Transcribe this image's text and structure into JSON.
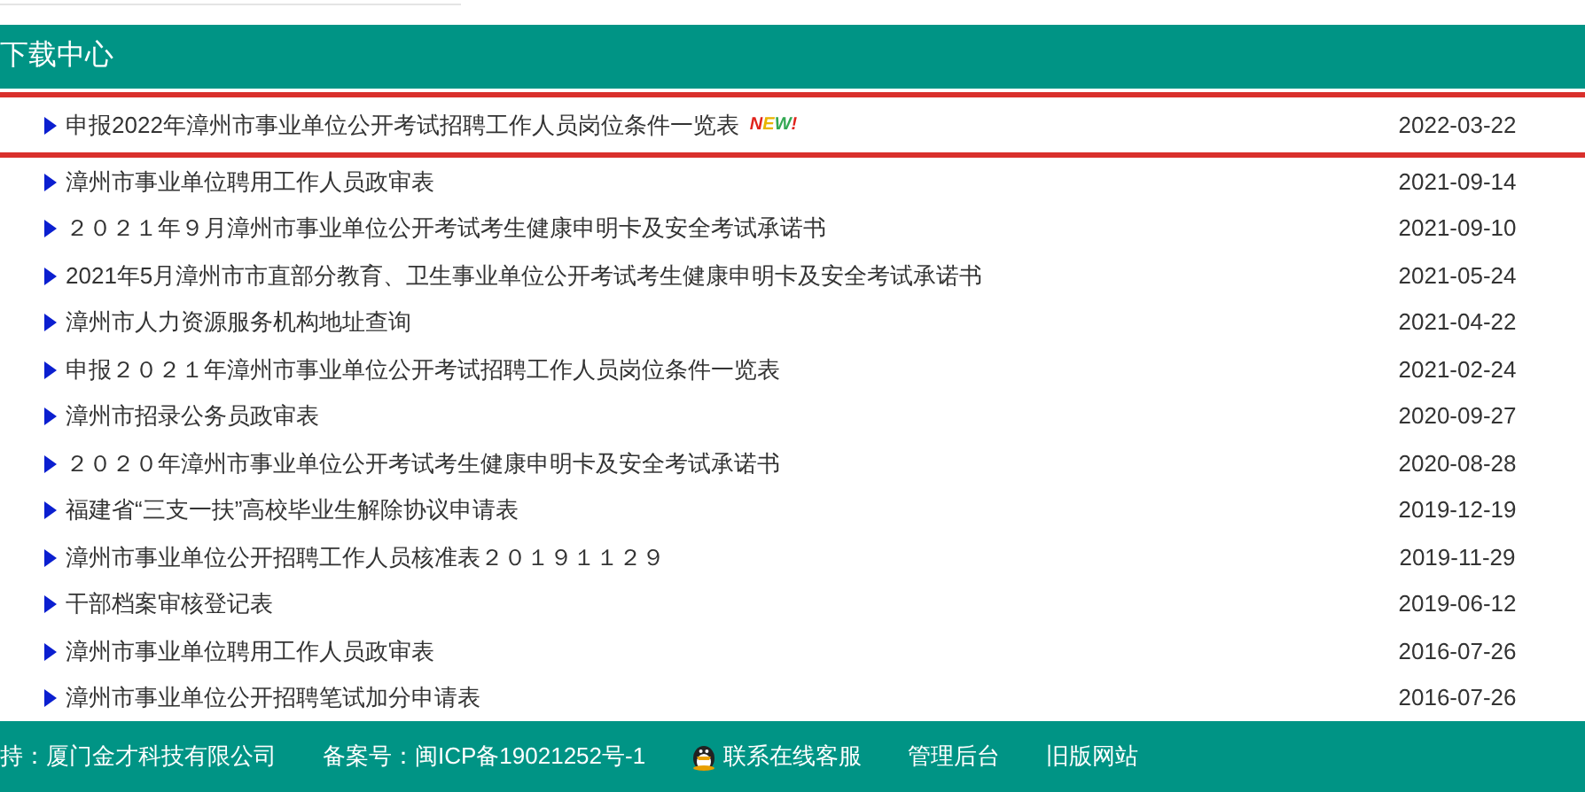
{
  "section": {
    "title": "下载中心"
  },
  "rows": [
    {
      "title": "申报2022年漳州市事业单位公开考试招聘工作人员岗位条件一览表",
      "date": "2022-03-22",
      "highlighted": true,
      "badge": "NEW!"
    },
    {
      "title": "漳州市事业单位聘用工作人员政审表",
      "date": "2021-09-14",
      "highlighted": false
    },
    {
      "title": "２０２１年９月漳州市事业单位公开考试考生健康申明卡及安全考试承诺书",
      "date": "2021-09-10",
      "highlighted": false
    },
    {
      "title": "2021年5月漳州市市直部分教育、卫生事业单位公开考试考生健康申明卡及安全考试承诺书",
      "date": "2021-05-24",
      "highlighted": false
    },
    {
      "title": "漳州市人力资源服务机构地址查询",
      "date": "2021-04-22",
      "highlighted": false
    },
    {
      "title": "申报２０２１年漳州市事业单位公开考试招聘工作人员岗位条件一览表",
      "date": "2021-02-24",
      "highlighted": false
    },
    {
      "title": "漳州市招录公务员政审表",
      "date": "2020-09-27",
      "highlighted": false
    },
    {
      "title": "２０２０年漳州市事业单位公开考试考生健康申明卡及安全考试承诺书",
      "date": "2020-08-28",
      "highlighted": false
    },
    {
      "title": "福建省“三支一扶”高校毕业生解除协议申请表",
      "date": "2019-12-19",
      "highlighted": false
    },
    {
      "title": "漳州市事业单位公开招聘工作人员核准表２０１９１１２９",
      "date": "2019-11-29",
      "highlighted": false
    },
    {
      "title": "干部档案审核登记表",
      "date": "2019-06-12",
      "highlighted": false
    },
    {
      "title": "漳州市事业单位聘用工作人员政审表",
      "date": "2016-07-26",
      "highlighted": false
    },
    {
      "title": "漳州市事业单位公开招聘笔试加分申请表",
      "date": "2016-07-26",
      "highlighted": false
    }
  ],
  "footer": {
    "support": "持：厦门金才科技有限公司",
    "icp": "备案号：闽ICP备19021252号-1",
    "links": [
      {
        "label": "联系在线客服",
        "kind": "qq"
      },
      {
        "label": "管理后台",
        "kind": "plain"
      },
      {
        "label": "旧版网站",
        "kind": "plain"
      }
    ]
  }
}
